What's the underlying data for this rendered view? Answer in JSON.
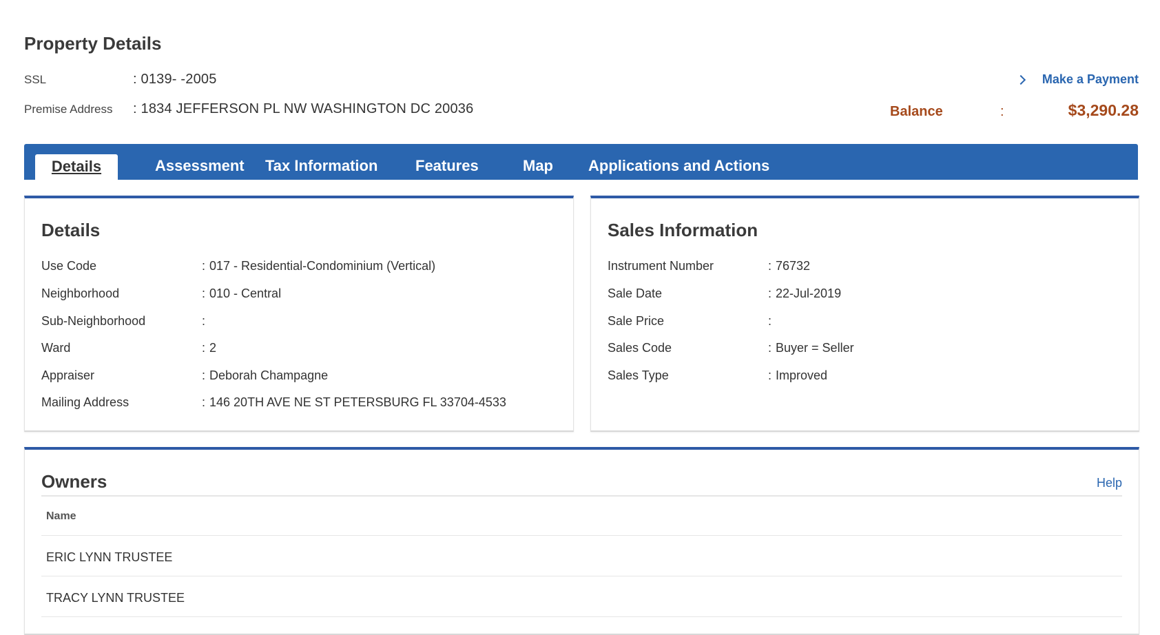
{
  "page": {
    "title": "Property Details"
  },
  "meta": {
    "ssl_label": "SSL",
    "ssl_value": ": 0139- -2005",
    "premise_label": "Premise Address",
    "premise_value": ": 1834 JEFFERSON PL NW WASHINGTON DC 20036"
  },
  "payment": {
    "label": "Make a Payment",
    "icon": "chevron-right-icon"
  },
  "balance": {
    "label": "Balance",
    "colon": ":",
    "value": "$3,290.28",
    "color": "#a5491b"
  },
  "tabs": [
    {
      "label": "Details",
      "active": true
    },
    {
      "label": "Assessment"
    },
    {
      "label": "Tax Information"
    },
    {
      "label": "Features"
    },
    {
      "label": "Map"
    },
    {
      "label": "Applications and Actions"
    }
  ],
  "details": {
    "title": "Details",
    "rows": [
      {
        "label": "Use Code",
        "value": "017 - Residential-Condominium (Vertical)"
      },
      {
        "label": "Neighborhood",
        "value": "010 - Central"
      },
      {
        "label": "Sub-Neighborhood",
        "value": ""
      },
      {
        "label": "Ward",
        "value": "2"
      },
      {
        "label": "Appraiser",
        "value": "Deborah Champagne"
      },
      {
        "label": "Mailing Address",
        "value": "146 20TH AVE NE ST PETERSBURG FL 33704-4533"
      }
    ]
  },
  "sales": {
    "title": "Sales Information",
    "rows": [
      {
        "label": "Instrument Number",
        "value": "76732"
      },
      {
        "label": "Sale Date",
        "value": "22-Jul-2019"
      },
      {
        "label": "Sale Price",
        "value": ""
      },
      {
        "label": "Sales Code",
        "value": "Buyer = Seller"
      },
      {
        "label": "Sales Type",
        "value": "Improved"
      }
    ]
  },
  "owners": {
    "title": "Owners",
    "help_label": "Help",
    "column_header": "Name",
    "rows": [
      "ERIC LYNN TRUSTEE",
      "TRACY LYNN TRUSTEE"
    ]
  },
  "colors": {
    "accent": "#2a66b0",
    "card_border": "#2e5aa6"
  }
}
